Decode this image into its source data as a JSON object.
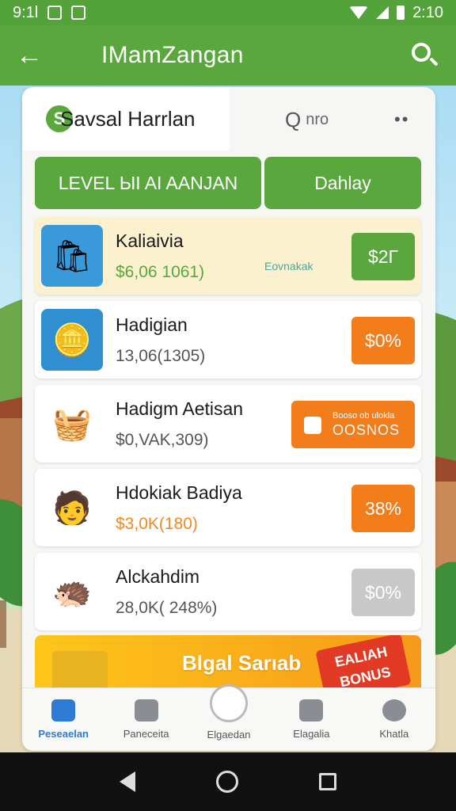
{
  "status": {
    "time_left": "9:1l",
    "time_right": "2:10"
  },
  "appbar": {
    "title": "IMamZangan",
    "back_icon": "back-arrow-icon",
    "search_icon": "search-icon"
  },
  "header": {
    "brand_name": "Savsal Harrlan",
    "mini_search_label": "nro"
  },
  "tabs": [
    {
      "label": "LEVEL ЫI AI AANJAN"
    },
    {
      "label": "Dahlay"
    }
  ],
  "rows": [
    {
      "name": "Kaliaivia",
      "amount": "$6,06  1061)",
      "note": "Eovnakak",
      "badge": "$2Г",
      "badge_color": "green"
    },
    {
      "name": "Hadigian",
      "amount": "13,06(1305)",
      "badge": "$0%",
      "badge_color": "orange"
    },
    {
      "name": "Hadigm Aetisan",
      "amount": "$0,VAK,309)",
      "badge_small": "Booso ob ulokla",
      "badge_big": "OOSNOS",
      "badge_color": "orange"
    },
    {
      "name": "Hdokiak Badiya",
      "amount": "$3,0K(180)",
      "badge": "38%",
      "badge_color": "orange"
    },
    {
      "name": "Alckahdim",
      "amount": "28,0K( 248%)",
      "badge": "$0%",
      "badge_color": "gray"
    }
  ],
  "banner": {
    "text": "Blgal Sarıab",
    "bonus_line1": "EALIAH",
    "bonus_line2": "BONUS"
  },
  "bottomnav": [
    {
      "label": "Peseaelan",
      "icon": "home-icon"
    },
    {
      "label": "Paneceita",
      "icon": "camera-icon"
    },
    {
      "label": "Elgaedan",
      "icon": "gift-icon"
    },
    {
      "label": "Elagalia",
      "icon": "bird-icon"
    },
    {
      "label": "Khatla",
      "icon": "compass-icon"
    }
  ]
}
